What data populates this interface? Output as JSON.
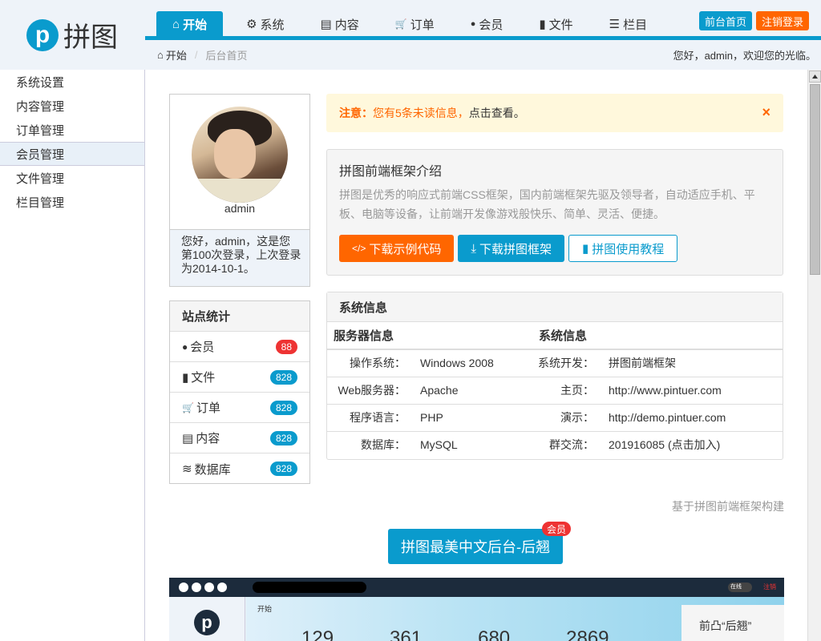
{
  "logo": {
    "mark": "p",
    "text": "拼图"
  },
  "topnav": [
    {
      "icon": "home-icon",
      "glyph": "⌂",
      "label": "开始"
    },
    {
      "icon": "gear-icon",
      "glyph": "⚙",
      "label": "系统"
    },
    {
      "icon": "file-text-icon",
      "glyph": "▤",
      "label": "内容"
    },
    {
      "icon": "cart-icon",
      "glyph": "🛒",
      "label": "订单"
    },
    {
      "icon": "user-icon",
      "glyph": "●",
      "label": "会员"
    },
    {
      "icon": "file-icon",
      "glyph": "▮",
      "label": "文件"
    },
    {
      "icon": "list-icon",
      "glyph": "☰",
      "label": "栏目"
    }
  ],
  "header_buttons": {
    "front_home": "前台首页",
    "logout": "注销登录"
  },
  "breadcrumb": {
    "home": "开始",
    "current": "后台首页"
  },
  "welcome": "您好，admin，欢迎您的光临。",
  "sidebar": [
    {
      "label": "系统设置"
    },
    {
      "label": "内容管理"
    },
    {
      "label": "订单管理"
    },
    {
      "label": "会员管理"
    },
    {
      "label": "文件管理"
    },
    {
      "label": "栏目管理"
    }
  ],
  "profile": {
    "name": "admin",
    "message": "您好，admin，这是您第100次登录，上次登录为2014-10-1。"
  },
  "stats": {
    "title": "站点统计",
    "rows": [
      {
        "icon": "user-icon",
        "glyph": "●",
        "label": "会员",
        "count": "88",
        "color": "red"
      },
      {
        "icon": "file-icon",
        "glyph": "▮",
        "label": "文件",
        "count": "828",
        "color": "blue"
      },
      {
        "icon": "cart-icon",
        "glyph": "🛒",
        "label": "订单",
        "count": "828",
        "color": "blue"
      },
      {
        "icon": "file-text-icon",
        "glyph": "▤",
        "label": "内容",
        "count": "828",
        "color": "blue"
      },
      {
        "icon": "database-icon",
        "glyph": "≋",
        "label": "数据库",
        "count": "828",
        "color": "blue"
      }
    ]
  },
  "alert": {
    "strong": "注意：",
    "text": "您有5条未读信息，",
    "link": "点击查看。",
    "close": "×"
  },
  "intro": {
    "title": "拼图前端框架介绍",
    "desc": "拼图是优秀的响应式前端CSS框架，国内前端框架先驱及领导者，自动适应手机、平板、电脑等设备，让前端开发像游戏般快乐、简单、灵活、便捷。",
    "btn_code": "下载示例代码",
    "btn_download": "下载拼图框架",
    "btn_tutorial": "拼图使用教程"
  },
  "sysinfo": {
    "title": "系统信息",
    "col1": "服务器信息",
    "col2": "系统信息",
    "rows": [
      {
        "l1": "操作系统：",
        "v1": "Windows 2008",
        "l2": "系统开发：",
        "v2": "拼图前端框架"
      },
      {
        "l1": "Web服务器：",
        "v1": "Apache",
        "l2": "主页：",
        "v2": "http://www.pintuer.com"
      },
      {
        "l1": "程序语言：",
        "v1": "PHP",
        "l2": "演示：",
        "v2": "http://demo.pintuer.com"
      },
      {
        "l1": "数据库：",
        "v1": "MySQL",
        "l2": "群交流：",
        "v2": "201916085 (点击加入)"
      }
    ]
  },
  "built_by": "基于拼图前端框架构建",
  "big_button": {
    "label": "拼图最美中文后台-后翘",
    "badge": "会员"
  },
  "preview": {
    "breadcrumb": "开始",
    "numbers": [
      "129",
      "361",
      "680",
      "2869"
    ],
    "card": "前凸“后翘”",
    "logo": "p",
    "online": "在线",
    "logout": "注销"
  }
}
